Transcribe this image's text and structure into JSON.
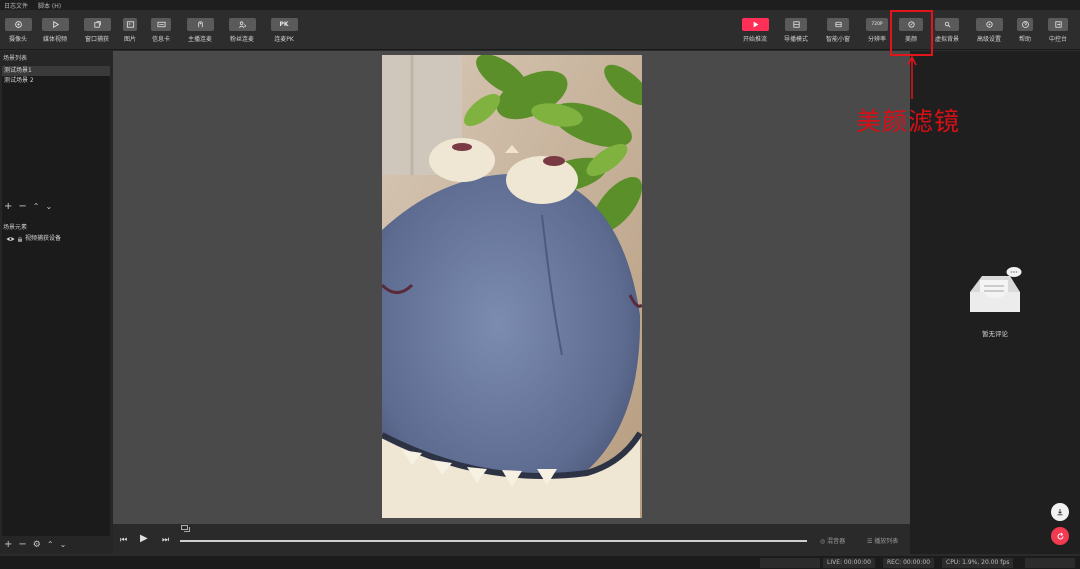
{
  "menu": [
    "日志文件",
    "脚本 (H)"
  ],
  "toolbar": {
    "left": [
      {
        "label": "摄像头",
        "icon": "camera-icon"
      },
      {
        "label": "媒体视频",
        "icon": "play-icon"
      },
      {
        "label": "窗口捕获",
        "icon": "window-icon"
      },
      {
        "label": "图片",
        "icon": "image-icon"
      },
      {
        "label": "信息卡",
        "icon": "card-icon"
      },
      {
        "label": "主播连麦",
        "icon": "cohost-icon"
      },
      {
        "label": "粉丝连麦",
        "icon": "fan-link-icon"
      },
      {
        "label": "连麦PK",
        "icon": "pk-icon",
        "text": "PK"
      }
    ],
    "right": [
      {
        "label": "开始推流",
        "icon": "start-stream-icon"
      },
      {
        "label": "导播模式",
        "icon": "director-icon"
      },
      {
        "label": "智能小窗",
        "icon": "smart-window-icon"
      },
      {
        "label": "分辨率",
        "icon": "resolution-icon",
        "text": "720P"
      },
      {
        "label": "美颜",
        "icon": "beauty-icon"
      },
      {
        "label": "虚拟背景",
        "icon": "virtual-bg-icon"
      },
      {
        "label": "高级设置",
        "icon": "settings-icon"
      },
      {
        "label": "帮助",
        "icon": "help-icon"
      },
      {
        "label": "中控台",
        "icon": "console-icon"
      }
    ]
  },
  "annotation": {
    "text": "美颜滤镜",
    "color": "#d80f16"
  },
  "scenes": {
    "title": "场景列表",
    "items": [
      "测试场景1",
      "测试场景 2"
    ],
    "selected": 0
  },
  "elements": {
    "title": "场景元素",
    "items": [
      "视频捕获设备"
    ]
  },
  "playback": {
    "mixer": "混音器",
    "playlist": "播放列表"
  },
  "comments": {
    "empty": "暂无评论"
  },
  "status": {
    "live": "LIVE: 00:00:00",
    "rec": "REC: 00:00:00",
    "cpu": "CPU: 1.9%, 20.00 fps"
  },
  "colors": {
    "accent": "#ff2f57",
    "highlight": "#e0161c"
  }
}
